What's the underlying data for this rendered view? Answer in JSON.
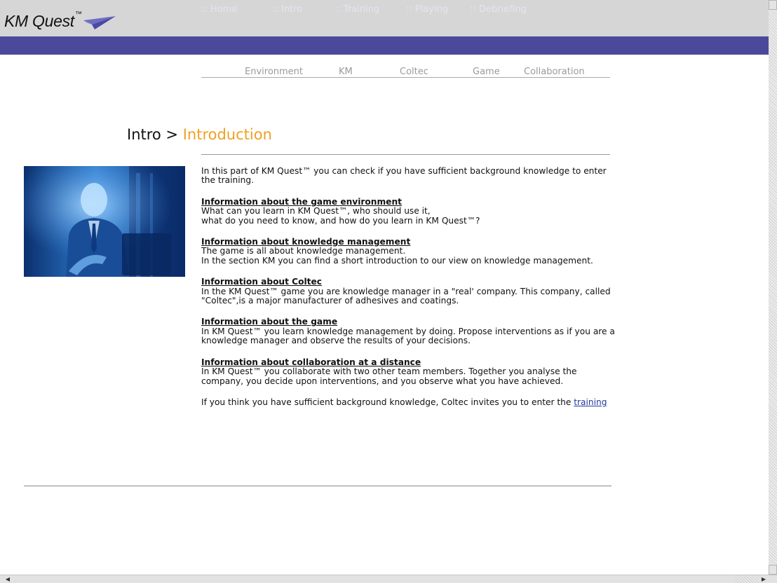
{
  "logo": {
    "name": "KM Quest",
    "tm": "™"
  },
  "nav": [
    "::  Home",
    "::  Intro",
    "::  Training",
    "::  Playing",
    "::  Debriefing"
  ],
  "subnav": [
    "Environment",
    "KM",
    "Coltec",
    "Game",
    "Collaboration"
  ],
  "breadcrumb": {
    "parent": "Intro >",
    "current": "Introduction"
  },
  "content": {
    "intro": "In this part of KM Quest™ you can check if you have sufficient background knowledge to enter the training.",
    "sections": [
      {
        "heading": "Information about the game environment",
        "lines": [
          "What can you learn in KM Quest™, who should use it,",
          "what do you need to know, and how do you learn in KM Quest™?"
        ]
      },
      {
        "heading": "Information about knowledge management",
        "lines": [
          "The game is all about knowledge management.",
          "In the section KM you can find a short introduction to our view on knowledge management."
        ]
      },
      {
        "heading": "Information about Coltec",
        "lines": [
          "In the KM Quest™ game you are knowledge manager in a \"real' company. This company, called \"Coltec\",is a major manufacturer of adhesives and coatings."
        ]
      },
      {
        "heading": "Information about the game",
        "lines": [
          "In KM Quest™ you learn knowledge management by doing. Propose interventions as if you are a knowledge manager and observe the results of your decisions."
        ]
      },
      {
        "heading": "Information about collaboration at a distance",
        "lines": [
          "In KM Quest™ you collaborate with two other team members. Together you analyse the company, you decide upon interventions, and you observe what you have achieved."
        ]
      }
    ],
    "closing_text": "If you think you have sufficient background knowledge, Coltec invites you to enter the",
    "closing_link": "training"
  },
  "colors": {
    "nav_bg": "#4b4a9a",
    "accent": "#f0a021",
    "header_bg": "#d6d6d6"
  }
}
